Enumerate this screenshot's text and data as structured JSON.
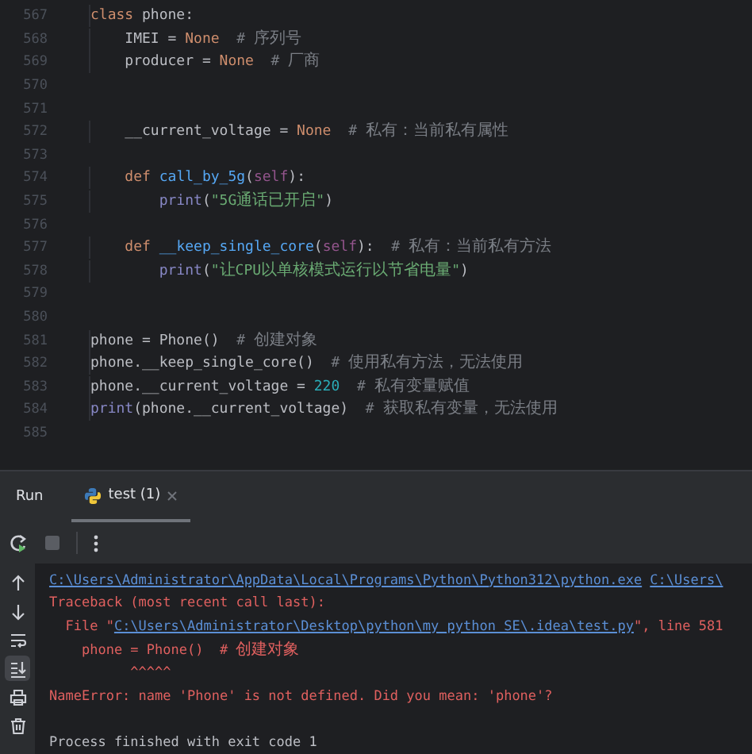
{
  "editor": {
    "lines": [
      {
        "number": "567",
        "tokens": [
          {
            "kind": "keyword",
            "text": "class"
          },
          {
            "kind": "plain",
            "text": " phone:"
          }
        ]
      },
      {
        "number": "568",
        "tokens": [
          {
            "kind": "plain",
            "text": "    IMEI = "
          },
          {
            "kind": "keyword",
            "text": "None"
          },
          {
            "kind": "comment",
            "text": "  # 序列号"
          }
        ]
      },
      {
        "number": "569",
        "tokens": [
          {
            "kind": "plain",
            "text": "    producer = "
          },
          {
            "kind": "keyword",
            "text": "None"
          },
          {
            "kind": "comment",
            "text": "  # 厂商"
          }
        ]
      },
      {
        "number": "570"
      },
      {
        "number": "571"
      },
      {
        "number": "572",
        "tokens": [
          {
            "kind": "plain",
            "text": "    __current_voltage = "
          },
          {
            "kind": "keyword",
            "text": "None"
          },
          {
            "kind": "comment",
            "text": "  # 私有：当前私有属性"
          }
        ]
      },
      {
        "number": "573"
      },
      {
        "number": "574",
        "tokens": [
          {
            "kind": "keyword",
            "text": "    def"
          },
          {
            "kind": "function",
            "text": " call_by_5g"
          },
          {
            "kind": "plain",
            "text": "("
          },
          {
            "kind": "self",
            "text": "self"
          },
          {
            "kind": "plain",
            "text": "):"
          }
        ]
      },
      {
        "number": "575",
        "tokens": [
          {
            "kind": "builtin",
            "text": "        print"
          },
          {
            "kind": "plain",
            "text": "("
          },
          {
            "kind": "string",
            "text": "\"5G通话已开启\""
          },
          {
            "kind": "plain",
            "text": ")"
          }
        ]
      },
      {
        "number": "576"
      },
      {
        "number": "577",
        "tokens": [
          {
            "kind": "keyword",
            "text": "    def"
          },
          {
            "kind": "function",
            "text": " __keep_single_core"
          },
          {
            "kind": "plain",
            "text": "("
          },
          {
            "kind": "self",
            "text": "self"
          },
          {
            "kind": "plain",
            "text": "):"
          },
          {
            "kind": "comment",
            "text": "  # 私有：当前私有方法"
          }
        ]
      },
      {
        "number": "578",
        "tokens": [
          {
            "kind": "builtin",
            "text": "        print"
          },
          {
            "kind": "plain",
            "text": "("
          },
          {
            "kind": "string",
            "text": "\"让CPU以单核模式运行以节省电量\""
          },
          {
            "kind": "plain",
            "text": ")"
          }
        ]
      },
      {
        "number": "579"
      },
      {
        "number": "580"
      },
      {
        "number": "581",
        "tokens": [
          {
            "kind": "plain",
            "text": "phone = Phone()"
          },
          {
            "kind": "comment",
            "text": "  # 创建对象"
          }
        ]
      },
      {
        "number": "582",
        "tokens": [
          {
            "kind": "plain",
            "text": "phone.__keep_single_core()"
          },
          {
            "kind": "comment",
            "text": "  # 使用私有方法，无法使用"
          }
        ]
      },
      {
        "number": "583",
        "tokens": [
          {
            "kind": "plain",
            "text": "phone.__current_voltage = "
          },
          {
            "kind": "number",
            "text": "220"
          },
          {
            "kind": "comment",
            "text": "  # 私有变量赋值"
          }
        ]
      },
      {
        "number": "584",
        "tokens": [
          {
            "kind": "builtin",
            "text": "print"
          },
          {
            "kind": "plain",
            "text": "(phone.__current_voltage)"
          },
          {
            "kind": "comment",
            "text": "  # 获取私有变量，无法使用"
          }
        ]
      },
      {
        "number": "585"
      }
    ]
  },
  "run_panel": {
    "title": "Run",
    "tabs": [
      {
        "label": "test (1)",
        "selected": true
      }
    ],
    "console": [
      {
        "segments": [
          {
            "kind": "link",
            "text": "C:\\Users\\Administrator\\AppData\\Local\\Programs\\Python\\Python312\\python.exe"
          },
          {
            "kind": "link",
            "text": "C:\\Users\\"
          }
        ]
      },
      {
        "segments": [
          {
            "kind": "error",
            "text": "Traceback (most recent call last):"
          }
        ]
      },
      {
        "segments": [
          {
            "kind": "error",
            "text": "  File \""
          },
          {
            "kind": "link",
            "text": "C:\\Users\\Administrator\\Desktop\\python\\my_python_SE\\.idea\\test.py"
          },
          {
            "kind": "error",
            "text": "\", line 581"
          }
        ]
      },
      {
        "segments": [
          {
            "kind": "error",
            "text": "    phone = Phone()  # 创建对象"
          }
        ]
      },
      {
        "segments": [
          {
            "kind": "error",
            "text": "          ^^^^^"
          }
        ]
      },
      {
        "segments": [
          {
            "kind": "error",
            "text": "NameError: name 'Phone' is not defined. Did you mean: 'phone'?"
          }
        ]
      },
      {
        "kind": "status",
        "segments": [
          {
            "kind": "text",
            "text": "Process finished with exit code 1"
          }
        ]
      }
    ],
    "side_tools": [
      {
        "kind": "up",
        "selected": false
      },
      {
        "kind": "down",
        "selected": false
      },
      {
        "kind": "wrap",
        "selected": false
      },
      {
        "kind": "scroll-end",
        "selected": true
      },
      {
        "kind": "print",
        "selected": false
      },
      {
        "kind": "trash",
        "selected": false
      }
    ]
  }
}
